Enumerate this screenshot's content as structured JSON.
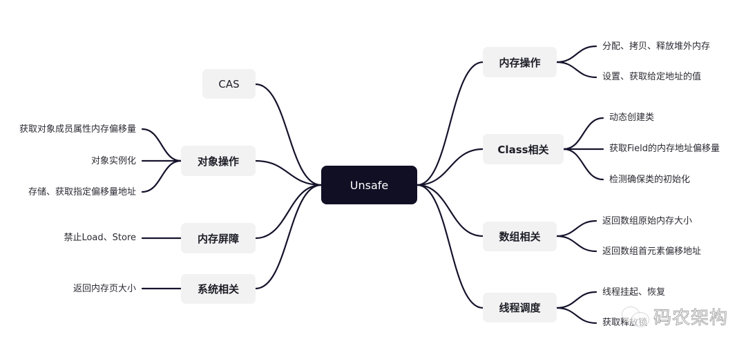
{
  "root": {
    "label": "Unsafe"
  },
  "left_branches": [
    {
      "label": "CAS",
      "children": []
    },
    {
      "label": "对象操作",
      "children": [
        "获取对象成员属性内存偏移量",
        "对象实例化",
        "存储、获取指定偏移量地址"
      ]
    },
    {
      "label": "内存屏障",
      "children": [
        "禁止Load、Store"
      ]
    },
    {
      "label": "系统相关",
      "children": [
        "返回内存页大小"
      ]
    }
  ],
  "right_branches": [
    {
      "label": "内存操作",
      "children": [
        "分配、拷贝、释放堆外内存",
        "设置、获取给定地址的值"
      ]
    },
    {
      "label": "Class相关",
      "children": [
        "动态创建类",
        "获取Field的内存地址偏移量",
        "检测确保类的初始化"
      ]
    },
    {
      "label": "数组相关",
      "children": [
        "返回数组原始内存大小",
        "返回数组首元素偏移地址"
      ]
    },
    {
      "label": "线程调度",
      "children": [
        "线程挂起、恢复",
        "获取释放锁"
      ]
    }
  ],
  "watermark": {
    "icon": "wechat-icon",
    "text": "码农架构"
  },
  "colors": {
    "root_bg": "#100f24",
    "node_bg": "#f2f2f3",
    "edge": "#15132b"
  }
}
